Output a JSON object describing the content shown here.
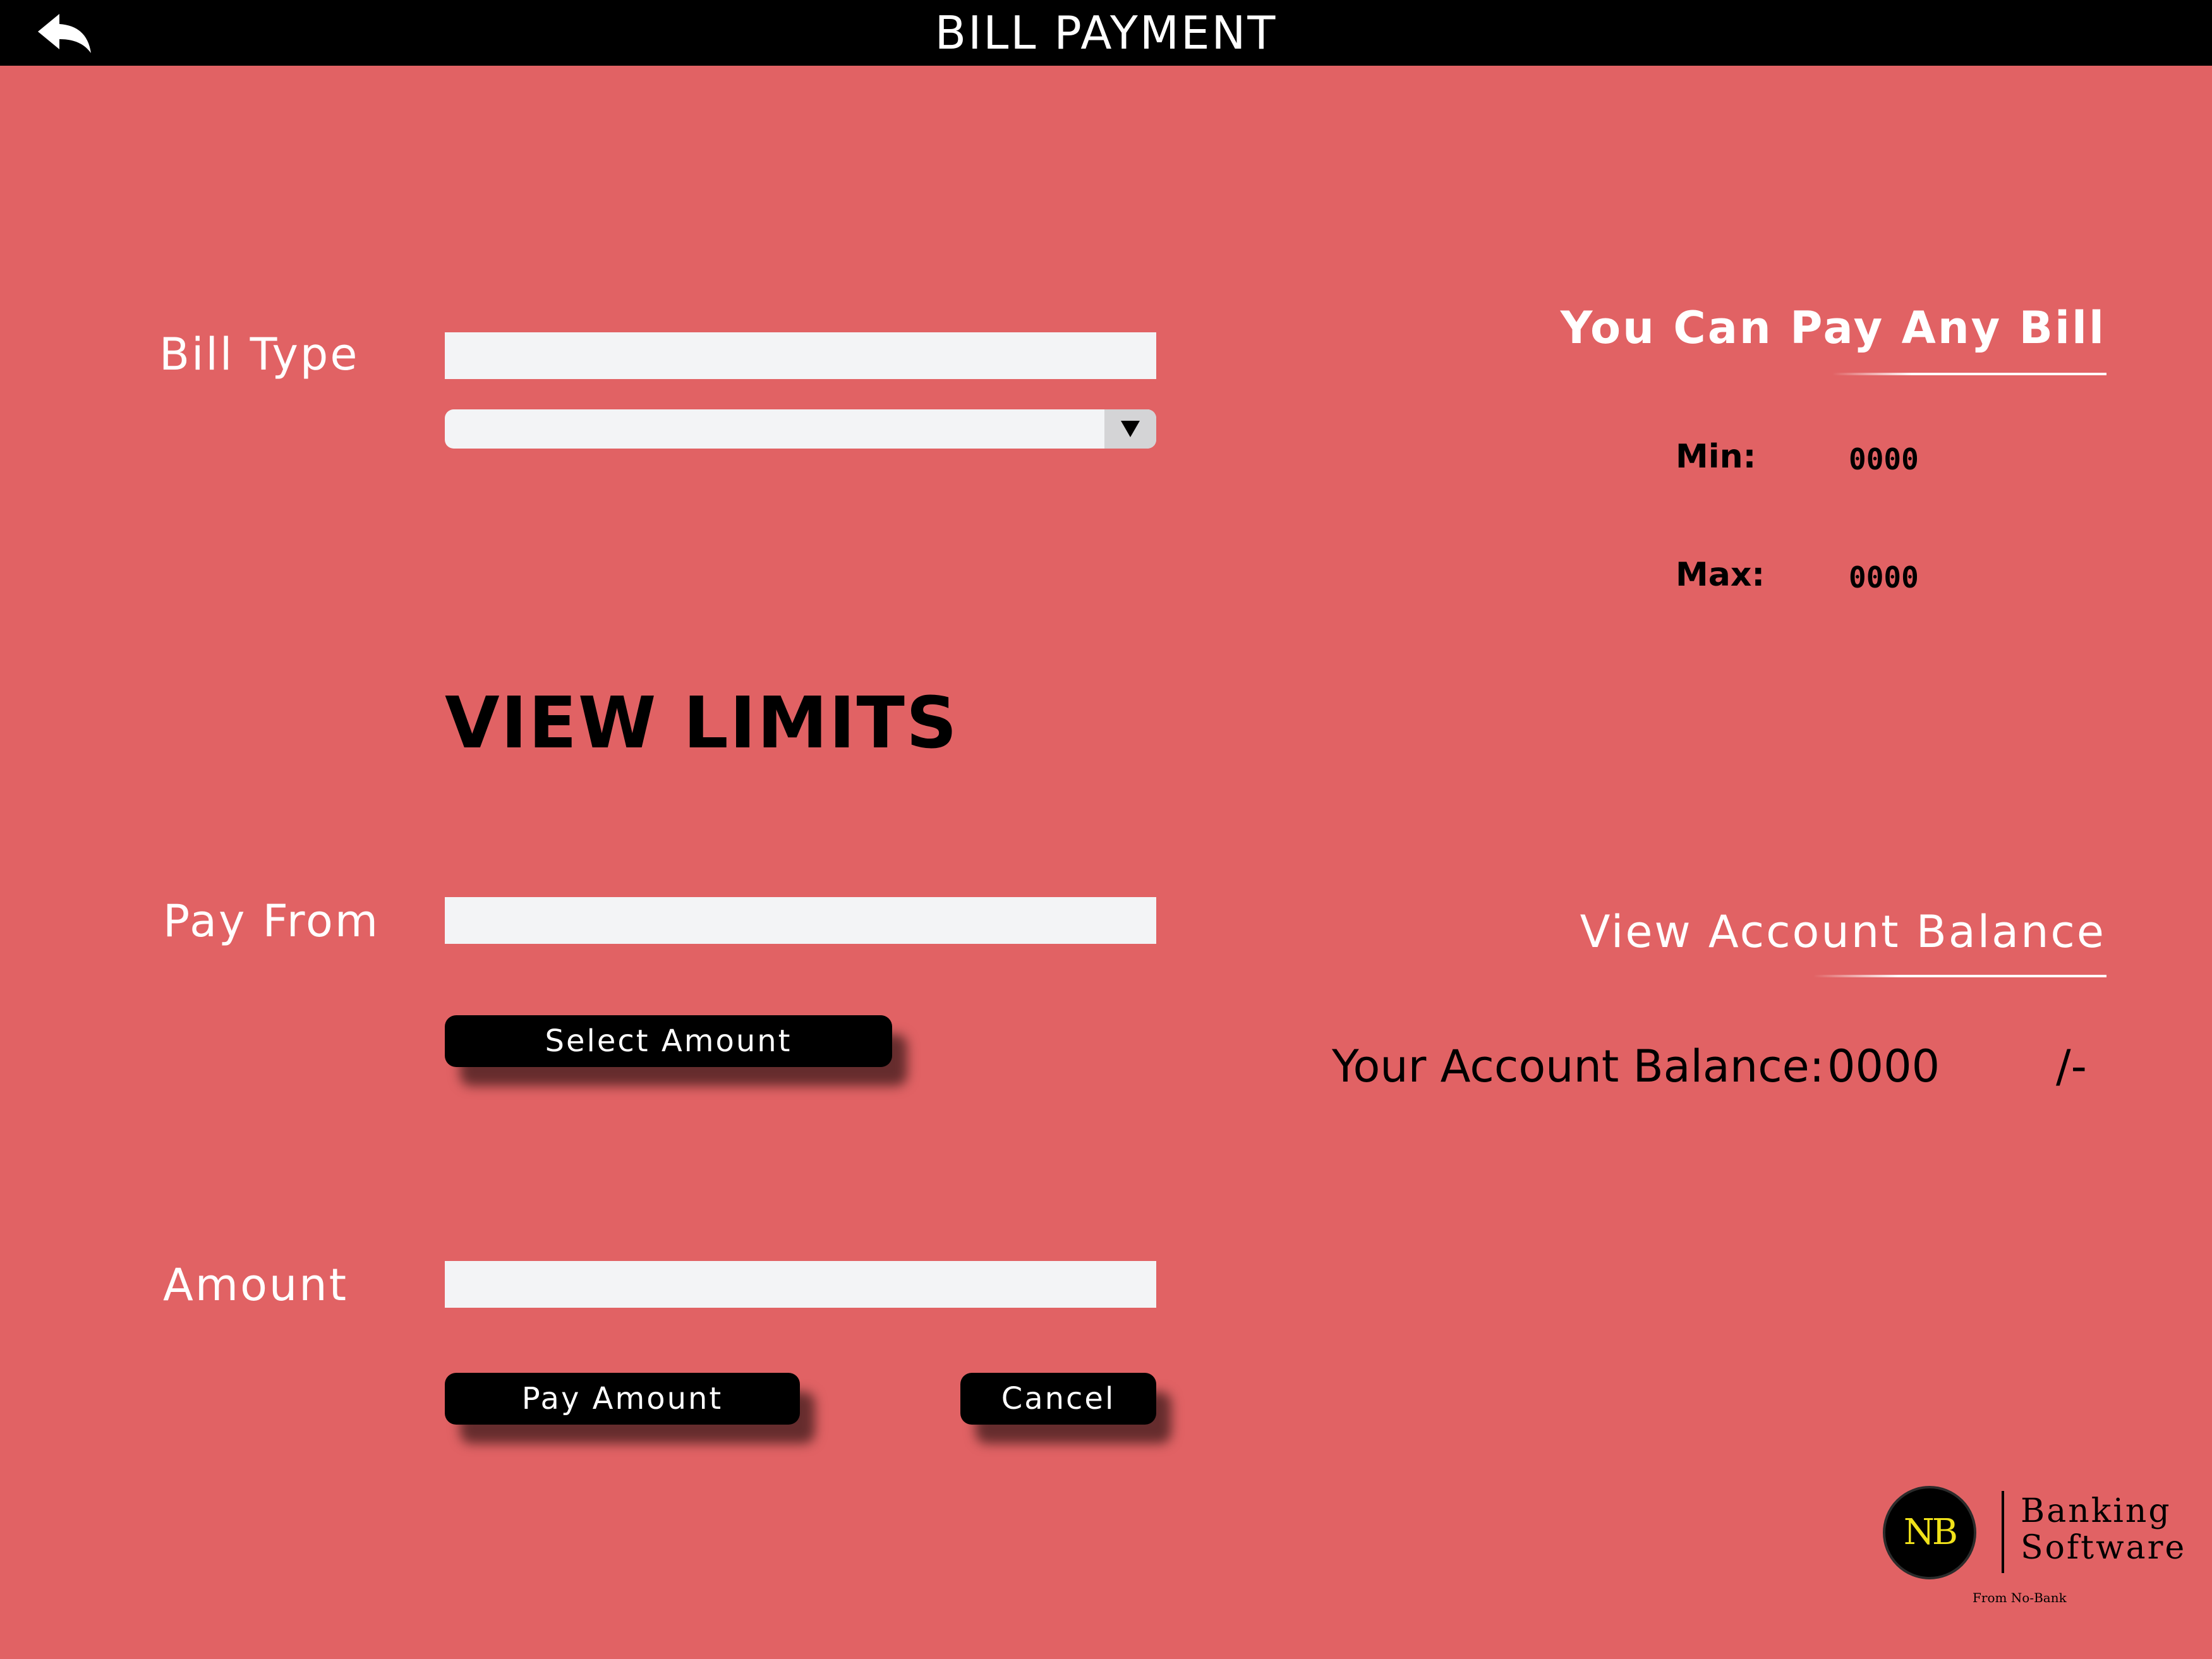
{
  "header": {
    "title": "BILL PAYMENT",
    "back_icon": "back-arrow-icon"
  },
  "form": {
    "bill_type_label": "Bill Type",
    "bill_type_value": "",
    "bill_type_select_value": "",
    "select_arrow_icon": "triangle-down-icon",
    "view_limits_heading": "VIEW LIMITS",
    "pay_from_label": "Pay From",
    "pay_from_value": "",
    "select_amount_label": "Select Amount",
    "amount_label": "Amount",
    "amount_value": "",
    "pay_amount_label": "Pay Amount",
    "cancel_label": "Cancel"
  },
  "limits": {
    "title": "You Can Pay Any Bill",
    "min_label": "Min:",
    "min_value": "0000",
    "max_label": "Max:",
    "max_value": "0000"
  },
  "balance": {
    "title": "View Account Balance",
    "label": "Your Account Balance:",
    "value": "0000",
    "suffix": "/-"
  },
  "logo": {
    "monogram": "NB",
    "line1": "Banking",
    "line2": "Software",
    "tagline": "From No-Bank"
  },
  "colors": {
    "background": "#e16264",
    "header": "#000000",
    "input": "#f3f4f6",
    "button": "#000000",
    "logo_accent": "#f1e21a"
  }
}
